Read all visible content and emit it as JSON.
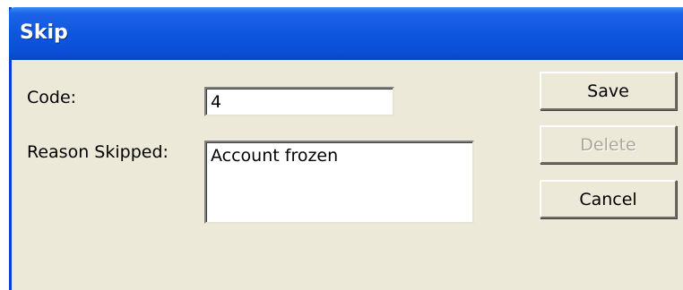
{
  "window": {
    "title": "Skip"
  },
  "form": {
    "code_label": "Code:",
    "code_value": "4",
    "reason_label": "Reason Skipped:",
    "reason_value": "Account frozen"
  },
  "buttons": {
    "save": "Save",
    "delete": "Delete",
    "delete_enabled": false,
    "cancel": "Cancel"
  }
}
